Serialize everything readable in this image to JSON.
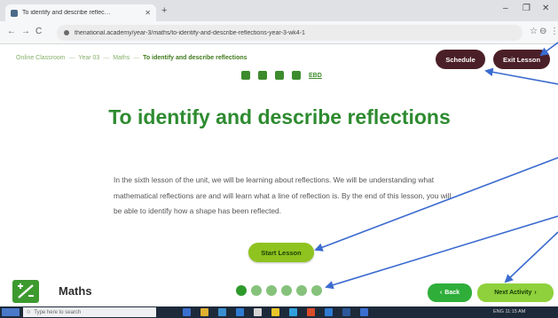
{
  "browser": {
    "tab_title": "To identify and describe reflec…",
    "tab_close": "✕",
    "new_tab": "+",
    "window_controls": [
      "–",
      "❐",
      "✕"
    ],
    "nav": [
      "←",
      "→",
      "C"
    ],
    "url": "thenational.academy/year-3/maths/to-identify-and-describe-reflections-year-3-wk4-1",
    "toolbar_right": [
      "☆",
      "⊖",
      "⋮"
    ]
  },
  "page": {
    "breadcrumb": [
      "Online Classroom",
      "Year 03",
      "Maths"
    ],
    "breadcrumb_current": "To identify and describe reflections",
    "breadcrumb_sep": "—",
    "schedule_label": "Schedule",
    "exit_label": "Exit Lesson",
    "icon_row_text": "EBD",
    "title": "To identify and describe reflections",
    "intro": "In the sixth lesson of the unit, we will be learning about reflections. We will be understanding what mathematical reflections are and will learn what a line of reflection is. By the end of this lesson, you will be able to identify how a shape has been reflected.",
    "start_label": "Start Lesson"
  },
  "footer": {
    "subject": "Maths",
    "progress_total": 6,
    "progress_active": 0,
    "back_label": "Back",
    "back_icon": "‹",
    "next_label": "Next Activity",
    "next_icon": "›"
  },
  "taskbar": {
    "search_placeholder": "Type here to search",
    "tray_text": "ENG 11:15 AM"
  },
  "colors": {
    "brand_green": "#2e8b30",
    "dark_button": "#4b1f27",
    "start_button": "#8fc31f",
    "arrow": "#3b6bd0"
  },
  "icons": [
    "browser-tab-favicon",
    "back-arrow-icon",
    "forward-arrow-icon",
    "reload-icon",
    "lock-icon",
    "star-icon",
    "profile-icon",
    "menu-icon",
    "maths-subject-icon",
    "windows-start-icon",
    "search-icon"
  ]
}
